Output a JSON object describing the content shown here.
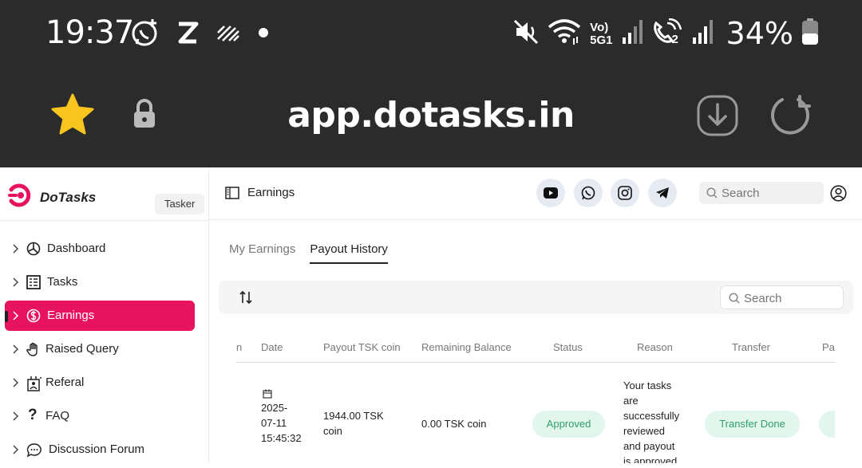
{
  "status_bar": {
    "time": "19:37",
    "left_icons": [
      "whatsapp-add-icon",
      "z-app-icon",
      "signal-lines-icon",
      "dot-icon"
    ],
    "right_icons": [
      "mute-icon",
      "wifi-icon",
      "volte-5g-icon",
      "signal-bars-icon",
      "wifi-call-icon",
      "signal-bars-2-icon"
    ],
    "net_label_top": "Vo)",
    "net_label_bottom": "5G1",
    "sim2_label": "2",
    "battery": "34%"
  },
  "browser": {
    "url": "app.dotasks.in",
    "icons": [
      "star-icon",
      "lock-icon",
      "download-icon",
      "reload-icon"
    ]
  },
  "sidebar": {
    "brand": "DoTasks",
    "role": "Tasker",
    "items": [
      {
        "label": "Dashboard",
        "icon": "dashboard-icon"
      },
      {
        "label": "Tasks",
        "icon": "tasks-icon"
      },
      {
        "label": "Earnings",
        "icon": "dollar-icon",
        "active": true
      },
      {
        "label": "Raised Query",
        "icon": "hand-icon"
      },
      {
        "label": "Referal",
        "icon": "referral-icon"
      },
      {
        "label": "FAQ",
        "icon": "question-icon"
      },
      {
        "label": "Discussion Forum",
        "icon": "chat-icon"
      }
    ],
    "accent": "#e8135f"
  },
  "header": {
    "title": "Earnings",
    "social": [
      "youtube-icon",
      "whatsapp-icon",
      "instagram-icon",
      "telegram-icon"
    ],
    "search_placeholder": "Search"
  },
  "tabs": [
    {
      "label": "My Earnings",
      "active": false
    },
    {
      "label": "Payout History",
      "active": true
    }
  ],
  "table": {
    "search_placeholder": "Search",
    "columns": [
      "n",
      "Date",
      "Payout TSK coin",
      "Remaining Balance",
      "Status",
      "Reason",
      "Transfer",
      "Pa"
    ],
    "rows": [
      {
        "date_l1": "2025-",
        "date_l2": "07-11",
        "date_l3": "15:45:32",
        "payout_l1": "1944.00 TSK",
        "payout_l2": "coin",
        "remaining": "0.00 TSK coin",
        "status": "Approved",
        "reason_lines": [
          "Your tasks",
          "are",
          "successfully",
          "reviewed",
          "and payout",
          "is approved"
        ],
        "transfer": "Transfer Done"
      }
    ]
  }
}
